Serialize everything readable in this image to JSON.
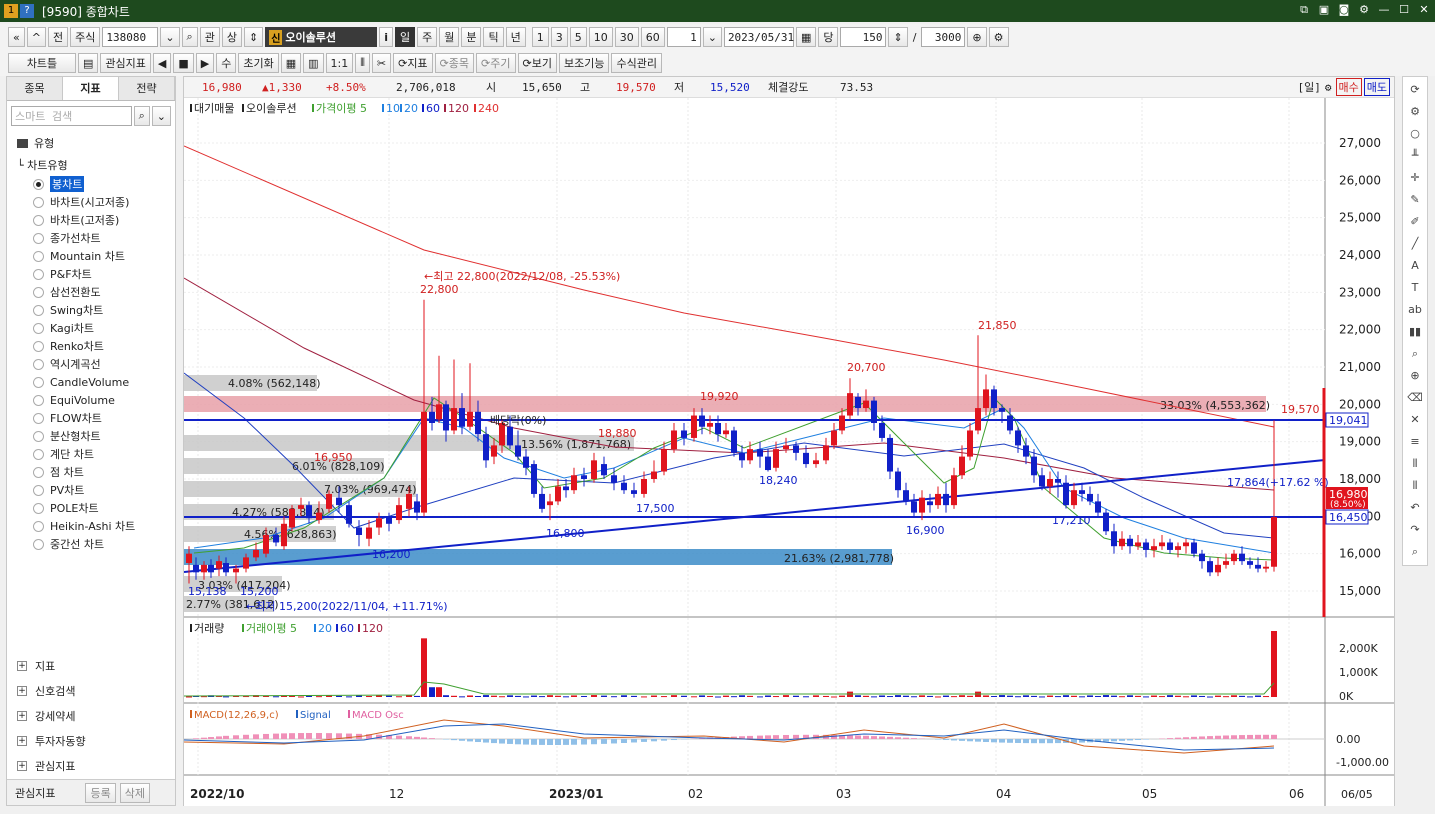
{
  "window": {
    "title": "[9590] 종합차트",
    "menu_label": "1",
    "help_label": "?"
  },
  "toolbar1": {
    "nav": [
      "«",
      "»",
      "전"
    ],
    "market": "주식",
    "code": "138080",
    "btns": [
      "관",
      "상"
    ],
    "stock_badge": "신",
    "stock_name": "오이솔루션",
    "info_btn": "i",
    "periods": [
      "일",
      "주",
      "월",
      "분",
      "틱",
      "년"
    ],
    "active_period": "일",
    "intervals": [
      "1",
      "3",
      "5",
      "10",
      "30",
      "60"
    ],
    "interval_value": "1",
    "date": "2023/05/31",
    "count_label": "당",
    "count": "150",
    "slash": "/",
    "total": "3000"
  },
  "toolbar2": {
    "chart_tool": "차트틀",
    "interest": "관심지표",
    "play": [
      "◀",
      "■",
      "▶"
    ],
    "su": "수",
    "reset": "초기화",
    "indicator": "지표",
    "item": "종목",
    "period": "주기",
    "view": "보기",
    "aux": "보조기능",
    "formula": "수식관리"
  },
  "sidebar": {
    "tabs": [
      "종목",
      "지표",
      "전략"
    ],
    "search_placeholder": "스마트 검색",
    "type_header": "유형",
    "chart_type_header": "차트유형",
    "chart_types": [
      "봉차트",
      "바차트(시고저종)",
      "바차트(고저종)",
      "종가선차트",
      "Mountain 차트",
      "P&F차트",
      "삼선전환도",
      "Swing차트",
      "Kagi차트",
      "Renko차트",
      "역시계곡선",
      "CandleVolume",
      "EquiVolume",
      "FLOW차트",
      "분산형차트",
      "계단 차트",
      "점 차트",
      "PV차트",
      "POLE차트",
      "Heikin-Ashi 차트",
      "중간선 차트"
    ],
    "selected": "봉차트",
    "groups": [
      "지표",
      "신호검색",
      "강세약세",
      "투자자동향",
      "관심지표"
    ],
    "bottom_label": "관심지표",
    "register": "등록",
    "delete": "삭제"
  },
  "price_bar": {
    "price": "16,980",
    "change": "▲1,330",
    "pct": "+8.50%",
    "volume": "2,706,018",
    "open_label": "시",
    "open": "15,650",
    "high_label": "고",
    "high": "19,570",
    "low_label": "저",
    "low": "15,520",
    "strength_label": "체결강도",
    "strength": "73.53",
    "period_tag": "[일]",
    "buy": "매수",
    "sell": "매도"
  },
  "legend_main": {
    "items": [
      "대기매물",
      "오이솔루션",
      "가격이평 5",
      "10",
      "20",
      "60",
      "120",
      "240"
    ]
  },
  "legend_vol": {
    "items": [
      "거래량",
      "거래이평 5",
      "20",
      "60",
      "120"
    ]
  },
  "legend_macd": {
    "items": [
      "MACD(12,26,9,c)",
      "Signal",
      "MACD Osc"
    ]
  },
  "annotations": {
    "high_note": "←최고 22,800(2022/12/08, -25.53%)",
    "low_note": "←최저 15,200(2022/11/04, +11.71%)",
    "dividend": "배당락(0%)",
    "trend_label": "17,864(+17.62 %)",
    "peaks": [
      "22,800",
      "19,920",
      "20,700",
      "21,850",
      "19,570",
      "18,240",
      "17,500",
      "17,210",
      "16,200",
      "16,900",
      "16,800",
      "18,880",
      "16,950",
      "15,200",
      "15,138"
    ],
    "hline_labels": [
      "19,041",
      "16,450",
      "16,980"
    ],
    "current_sub": "(8.50%)"
  },
  "volume_profile": [
    "4.08% (562,148)",
    "33.03% (4,553,362)",
    "13.56% (1,871,768)",
    "6.01% (828,109)",
    "7.03% (969,474)",
    "4.27% (588,824)",
    "4.56% (628,863)",
    "21.63% (2,981,778)",
    "3.03% (417,204)",
    "2.77% (381,612)"
  ],
  "axis": {
    "price_ticks": [
      "27,000",
      "26,000",
      "25,000",
      "24,000",
      "23,000",
      "22,000",
      "21,000",
      "20,000",
      "19,000",
      "18,000",
      "17,000",
      "16,000",
      "15,000"
    ],
    "vol_ticks": [
      "2,000K",
      "1,000K",
      "0K"
    ],
    "macd_ticks": [
      "0.00",
      "-1,000.00"
    ],
    "date_labels": [
      "2022/10",
      "12",
      "2023/01",
      "02",
      "03",
      "04",
      "05",
      "06"
    ],
    "last_date": "06/05"
  },
  "colors": {
    "up": "#e0141e",
    "down": "#1020c8",
    "profile_grey": "#c8c8c8",
    "profile_red": "#e8a0a8",
    "profile_blue": "#3c8cc8",
    "title_bg": "#1e4a1e"
  }
}
